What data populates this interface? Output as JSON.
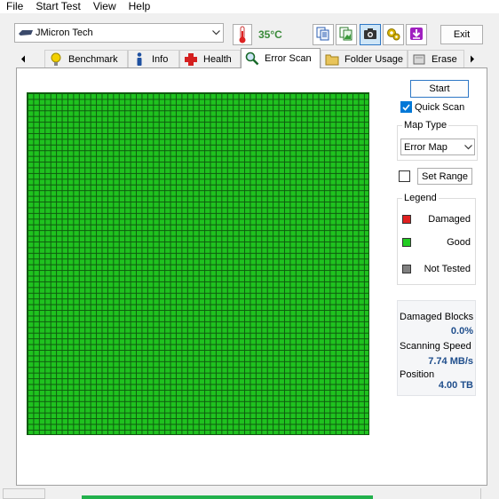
{
  "menu": [
    "File",
    "Start Test",
    "View",
    "Help"
  ],
  "toolbar": {
    "drive_name": "JMicron Tech",
    "temperature": "35°C",
    "temperature_color": "#3a8a3a",
    "exit_label": "Exit"
  },
  "tabs": [
    {
      "label": "Benchmark",
      "icon": "lightbulb-icon"
    },
    {
      "label": "Info",
      "icon": "info-icon"
    },
    {
      "label": "Health",
      "icon": "health-cross-icon"
    },
    {
      "label": "Error Scan",
      "icon": "magnifier-icon",
      "active": true
    },
    {
      "label": "Folder Usage",
      "icon": "folder-icon"
    },
    {
      "label": "Erase",
      "icon": "erase-icon"
    }
  ],
  "scan": {
    "start_label": "Start",
    "quick_scan_label": "Quick Scan",
    "quick_scan_checked": true,
    "map_type_title": "Map Type",
    "map_type_value": "Error Map",
    "set_range_label": "Set Range",
    "set_range_checked": false,
    "grid_color": "#1fc21f"
  },
  "legend": {
    "title": "Legend",
    "items": [
      {
        "label": "Damaged",
        "color": "#e02020"
      },
      {
        "label": "Good",
        "color": "#22cc22"
      },
      {
        "label": "Not Tested",
        "color": "#808080"
      }
    ]
  },
  "stats": {
    "damaged_blocks_label": "Damaged Blocks",
    "damaged_blocks_value": "0.0%",
    "scanning_speed_label": "Scanning Speed",
    "scanning_speed_value": "7.74 MB/s",
    "position_label": "Position",
    "position_value": "4.00 TB"
  },
  "progress": 1.0
}
